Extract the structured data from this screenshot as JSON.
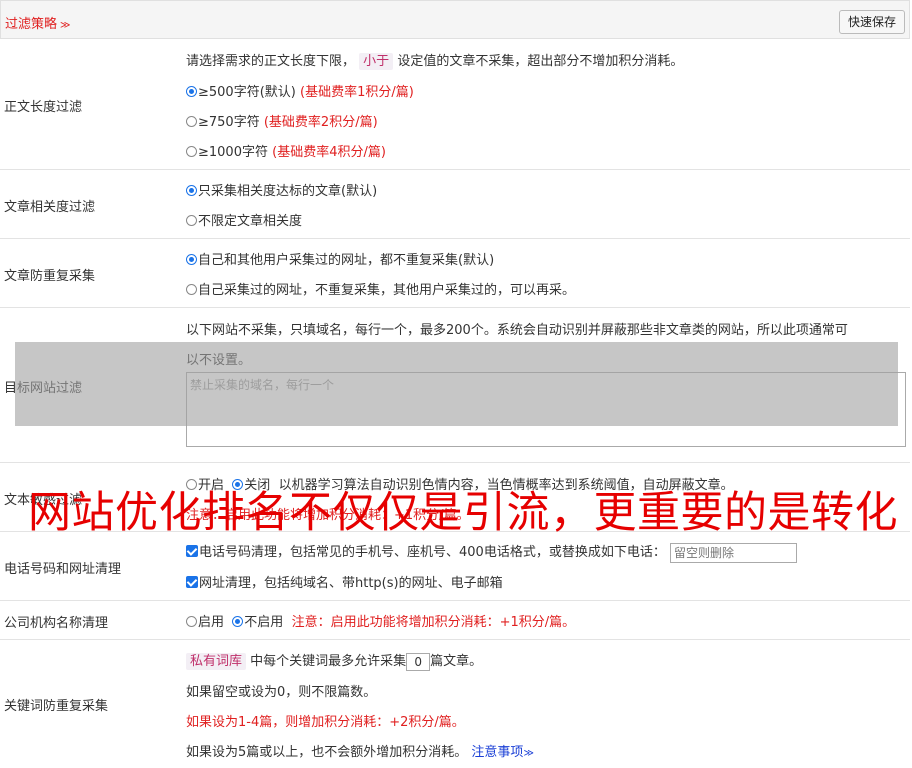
{
  "header": {
    "title": "过滤策略",
    "save_label": "快速保存"
  },
  "length_filter": {
    "label": "正文长度过滤",
    "desc_pre": "请选择需求的正文长度下限，",
    "desc_tag": "小于",
    "desc_post": "设定值的文章不采集，超出部分不增加积分消耗。",
    "opt1": "≥500字符(默认)",
    "opt1_note": "(基础费率1积分/篇)",
    "opt2": "≥750字符",
    "opt2_note": "(基础费率2积分/篇)",
    "opt3": "≥1000字符",
    "opt3_note": "(基础费率4积分/篇)"
  },
  "relevance": {
    "label": "文章相关度过滤",
    "opt1": "只采集相关度达标的文章(默认)",
    "opt2": "不限定文章相关度"
  },
  "dedupe": {
    "label": "文章防重复采集",
    "opt1": "自己和其他用户采集过的网址，都不重复采集(默认)",
    "opt2": "自己采集过的网址，不重复采集，其他用户采集过的，可以再采。"
  },
  "site_filter": {
    "label": "目标网站过滤",
    "desc1": "以下网站不采集，只填域名，每行一个，最多200个。系统会自动识别并屏蔽那些非文章类的网站，所以此项通常可",
    "desc2": "以不设置。",
    "placeholder": "禁止采集的域名，每行一个"
  },
  "sensitive": {
    "label": "文本敏感过滤",
    "opt_on": "开启",
    "opt_off": "关闭",
    "desc": "以机器学习算法自动识别色情内容，当色情概率达到系统阈值，自动屏蔽文章。",
    "note": "注意：启用此功能将增加积分消耗：+1积分/篇。"
  },
  "phone": {
    "label": "电话号码和网址清理",
    "opt1": "电话号码清理，包括常见的手机号、座机号、400电话格式，或替换成如下电话：",
    "input_placeholder": "留空则删除",
    "opt2": "网址清理，包括纯域名、带http(s)的网址、电子邮箱"
  },
  "org": {
    "label": "公司机构名称清理",
    "opt_on": "启用",
    "opt_off": "不启用",
    "note": "注意：启用此功能将增加积分消耗：+1积分/篇。"
  },
  "keyword": {
    "label": "关键词防重复采集",
    "tag": "私有词库",
    "line1_pre": "中每个关键词最多允许采集",
    "value": "0",
    "line1_post": "篇文章。",
    "line2": "如果留空或设为0，则不限篇数。",
    "line3": "如果设为1-4篇，则增加积分消耗：+2积分/篇。",
    "line4": "如果设为5篇或以上，也不会额外增加积分消耗。",
    "link": "注意事项"
  },
  "watermark": "网站优化排名不仅仅是引流，更重要的是转化"
}
